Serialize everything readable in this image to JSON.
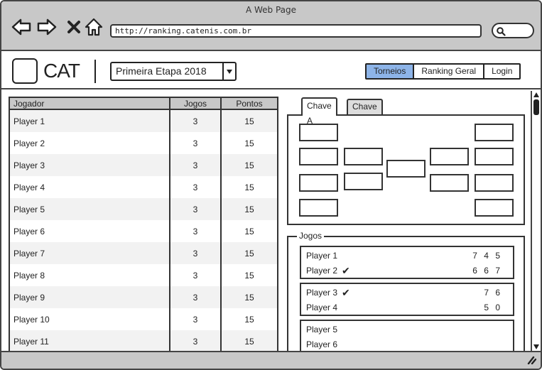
{
  "browser": {
    "window_title": "A Web Page",
    "url": "http://ranking.catenis.com.br"
  },
  "header": {
    "logo_text": "CAT",
    "stage_selected": "Primeira Etapa 2018",
    "nav": [
      {
        "label": "Torneios",
        "active": true
      },
      {
        "label": "Ranking Geral",
        "active": false
      },
      {
        "label": "Login",
        "active": false
      }
    ]
  },
  "ranking": {
    "columns": [
      "Jogador",
      "Jogos",
      "Pontos"
    ],
    "rows": [
      {
        "name": "Player 1",
        "jogos": "3",
        "pontos": "15"
      },
      {
        "name": "Player 2",
        "jogos": "3",
        "pontos": "15"
      },
      {
        "name": "Player 3",
        "jogos": "3",
        "pontos": "15"
      },
      {
        "name": "Player 4",
        "jogos": "3",
        "pontos": "15"
      },
      {
        "name": "Player 5",
        "jogos": "3",
        "pontos": "15"
      },
      {
        "name": "Player 6",
        "jogos": "3",
        "pontos": "15"
      },
      {
        "name": "Player 7",
        "jogos": "3",
        "pontos": "15"
      },
      {
        "name": "Player 8",
        "jogos": "3",
        "pontos": "15"
      },
      {
        "name": "Player 9",
        "jogos": "3",
        "pontos": "15"
      },
      {
        "name": "Player 10",
        "jogos": "3",
        "pontos": "15"
      },
      {
        "name": "Player 11",
        "jogos": "3",
        "pontos": "15"
      }
    ]
  },
  "bracket": {
    "tabs": [
      {
        "label": "Chave A",
        "active": true
      },
      {
        "label": "Chave B",
        "active": false
      }
    ]
  },
  "jogos": {
    "legend": "Jogos",
    "games": [
      {
        "players": [
          {
            "name": "Player 1",
            "winner": false,
            "score": "7 4 5"
          },
          {
            "name": "Player 2",
            "winner": true,
            "score": "6 6 7"
          }
        ]
      },
      {
        "players": [
          {
            "name": "Player 3",
            "winner": true,
            "score": "7 6"
          },
          {
            "name": "Player 4",
            "winner": false,
            "score": "5 0"
          }
        ]
      },
      {
        "players": [
          {
            "name": "Player 5",
            "winner": false,
            "score": ""
          },
          {
            "name": "Player 6",
            "winner": false,
            "score": ""
          }
        ]
      }
    ]
  },
  "colors": {
    "chrome_gray": "#c8c8c8",
    "active_tab": "#8db4e8",
    "row_alt": "#f2f2f2"
  },
  "icons": {
    "back": "arrow-left-icon",
    "forward": "arrow-right-icon",
    "stop": "close-icon",
    "home": "home-icon",
    "search": "search-icon",
    "winner": "check-icon",
    "dropdown": "chevron-down-icon",
    "resize": "resize-grip-icon"
  }
}
